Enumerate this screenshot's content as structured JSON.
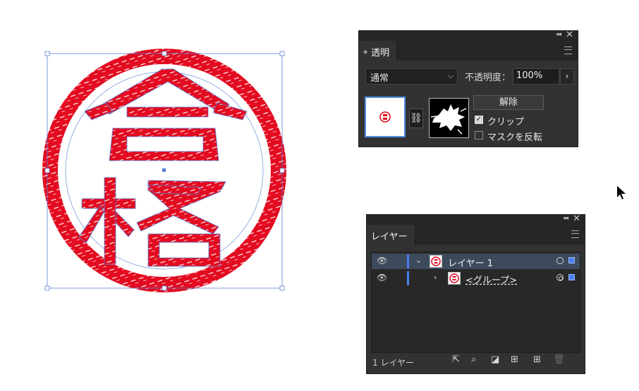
{
  "transparency_panel": {
    "tab_label": "透明",
    "blend_mode": "通常",
    "opacity_label": "不透明度：",
    "opacity_value": "100%",
    "release_button": "解除",
    "clip_label": "クリップ",
    "clip_checked": true,
    "invert_mask_label": "マスクを反転",
    "invert_mask_checked": false
  },
  "layers_panel": {
    "tab_label": "レイヤー",
    "layers": [
      {
        "name": "レイヤー 1",
        "selected": true,
        "expanded": true
      },
      {
        "name": "<グループ>",
        "selected": false,
        "expanded": false
      }
    ],
    "footer_count": "1 レイヤー"
  },
  "stamp": {
    "characters": "合格",
    "color": "#e30b20",
    "selection_color": "#5a7fd6"
  },
  "icons": {
    "eye": "eye-icon",
    "link": "chain-link-icon",
    "cursor": "mouse-pointer-icon"
  }
}
